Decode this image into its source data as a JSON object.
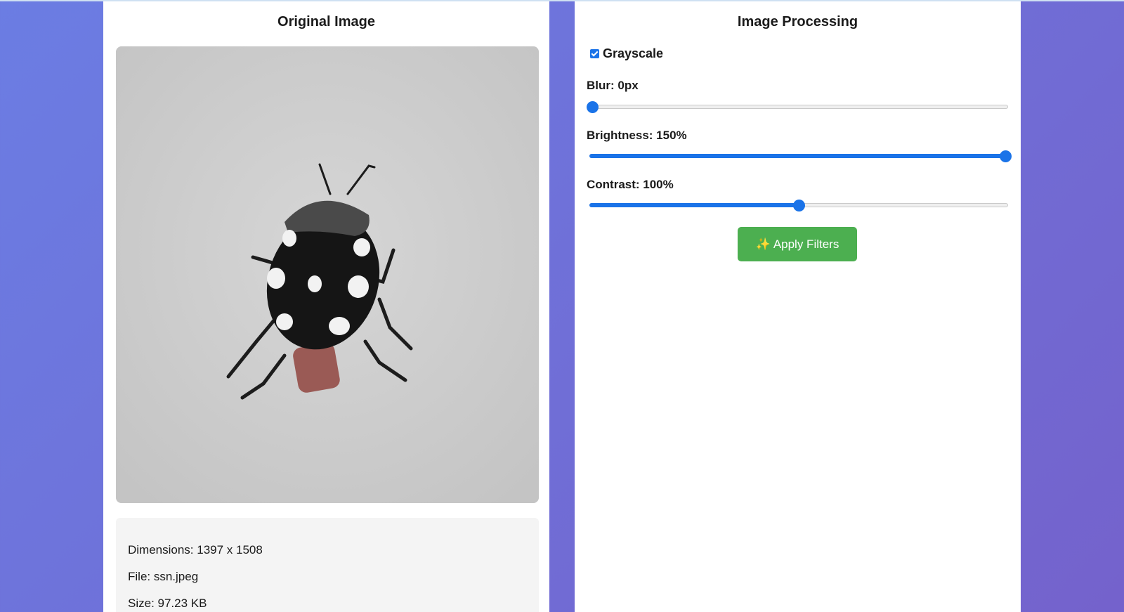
{
  "left_panel": {
    "title": "Original Image",
    "info": {
      "dimensions": "Dimensions: 1397 x 1508",
      "file": "File: ssn.jpeg",
      "size": "Size: 97.23 KB"
    }
  },
  "right_panel": {
    "title": "Image Processing",
    "grayscale": {
      "label": "Grayscale",
      "checked": true
    },
    "sliders": [
      {
        "label": "Blur: 0px",
        "value": 0,
        "min": 0,
        "max": 10
      },
      {
        "label": "Brightness: 150%",
        "value": 150,
        "min": 0,
        "max": 150
      },
      {
        "label": "Contrast: 100%",
        "value": 100,
        "min": 0,
        "max": 200
      }
    ],
    "apply_button": {
      "icon": "sparkles-icon",
      "label": "Apply Filters"
    }
  },
  "colors": {
    "accent": "#1a73e8",
    "apply_button": "#4caf50",
    "background_gradient_start": "#6b7de3",
    "background_gradient_end": "#7462cc"
  }
}
